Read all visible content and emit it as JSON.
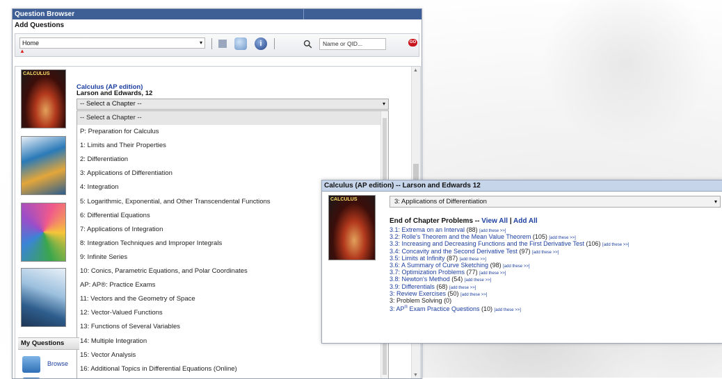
{
  "question_browser": {
    "title": "Question Browser",
    "subtitle": "Add Questions",
    "toolbar": {
      "location_value": "Home",
      "location_marker": "▲",
      "search_placeholder": "Name or QID...",
      "info_glyph": "i",
      "go_label": "GO"
    },
    "book": {
      "title": "Calculus (AP edition)",
      "author": "Larson and Edwards, 12",
      "cover_text": "CALCULUS"
    },
    "chapter_select_value": "-- Select a Chapter --",
    "chapters": [
      "-- Select a Chapter --",
      "P: Preparation for Calculus",
      "1: Limits and Their Properties",
      "2: Differentiation",
      "3: Applications of Differentiation",
      "4: Integration",
      "5: Logarithmic, Exponential, and Other Transcendental Functions",
      "6: Differential Equations",
      "7: Applications of Integration",
      "8: Integration Techniques and Improper Integrals",
      "9: Infinite Series",
      "10: Conics, Parametric Equations, and Polar Coordinates",
      "AP: AP®: Practice Exams",
      "11: Vectors and the Geometry of Space",
      "12: Vector-Valued Functions",
      "13: Functions of Several Variables",
      "14: Multiple Integration",
      "15: Vector Analysis",
      "16: Additional Topics in Differential Equations (Online)"
    ],
    "my_questions": {
      "heading": "My Questions",
      "browse_label": "Browse"
    }
  },
  "calculus_panel": {
    "title": "Calculus (AP edition) -- Larson and Edwards 12",
    "chapter_value": "3: Applications of Differentiation",
    "end_of_chapter": {
      "label": "End of Chapter Problems --",
      "view_all": "View All",
      "separator": "|",
      "add_all": "Add All"
    },
    "add_label": "[add these >>]",
    "sections": [
      {
        "name": "3.1: Extrema on an Interval",
        "count": "(88)"
      },
      {
        "name": "3.2: Rolle's Theorem and the Mean Value Theorem",
        "count": "(105)"
      },
      {
        "name": "3.3: Increasing and Decreasing Functions and the First Derivative Test",
        "count": "(106)"
      },
      {
        "name": "3.4: Concavity and the Second Derivative Test",
        "count": "(97)"
      },
      {
        "name": "3.5: Limits at Infinity",
        "count": "(87)"
      },
      {
        "name": "3.6: A Summary of Curve Sketching",
        "count": "(98)"
      },
      {
        "name": "3.7: Optimization Problems",
        "count": "(77)"
      },
      {
        "name": "3.8: Newton's Method",
        "count": "(54)"
      },
      {
        "name": "3.9: Differentials",
        "count": "(68)"
      },
      {
        "name": "3: Review Exercises",
        "count": "(50)"
      },
      {
        "name": "3: Problem Solving",
        "count": "(0)"
      },
      {
        "name": "3: AP",
        "sup": "®",
        "name_after": " Exam Practice Questions",
        "count": "(10)"
      }
    ]
  }
}
